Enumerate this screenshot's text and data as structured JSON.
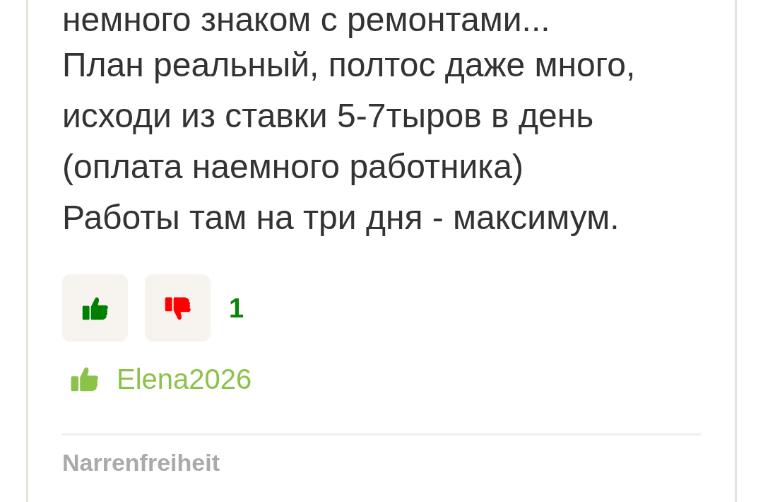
{
  "post": {
    "lines": [
      "немного знаком с ремонтами...",
      "План реальный, полтос даже много,",
      "исходи из ставки 5-7тыров в день",
      "(оплата наемного работника)",
      "Работы там на три дня - максимум."
    ],
    "vote_buttons": [
      {
        "kind": "up"
      },
      {
        "kind": "down"
      }
    ],
    "score": "1",
    "liked_by": [
      "Elena2026"
    ]
  },
  "next_post": {
    "author": "Narrenfreiheit"
  }
}
